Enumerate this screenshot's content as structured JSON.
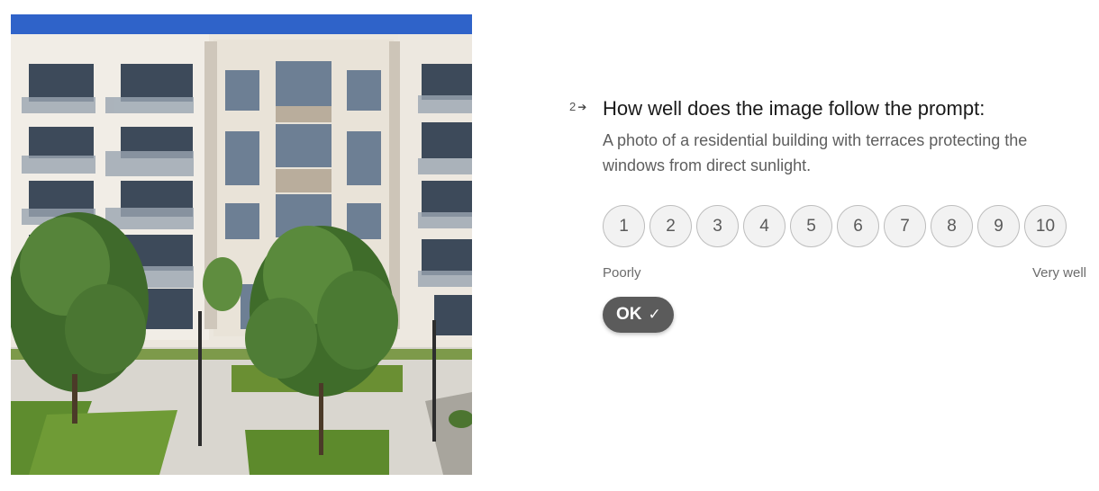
{
  "question": {
    "number": "2",
    "arrow_icon": "arrow-right-icon",
    "title": "How well does the image follow the prompt:",
    "description": "A photo of a residential building with terraces protecting the windows from direct sunlight."
  },
  "scale": {
    "options": [
      "1",
      "2",
      "3",
      "4",
      "5",
      "6",
      "7",
      "8",
      "9",
      "10"
    ],
    "low_label": "Poorly",
    "high_label": "Very well"
  },
  "ok_button": {
    "label": "OK",
    "icon": "checkmark-icon"
  },
  "colors": {
    "button_bg": "#5b5b5b",
    "scale_bg": "#f2f2f2",
    "scale_border": "#bdbdbd"
  }
}
